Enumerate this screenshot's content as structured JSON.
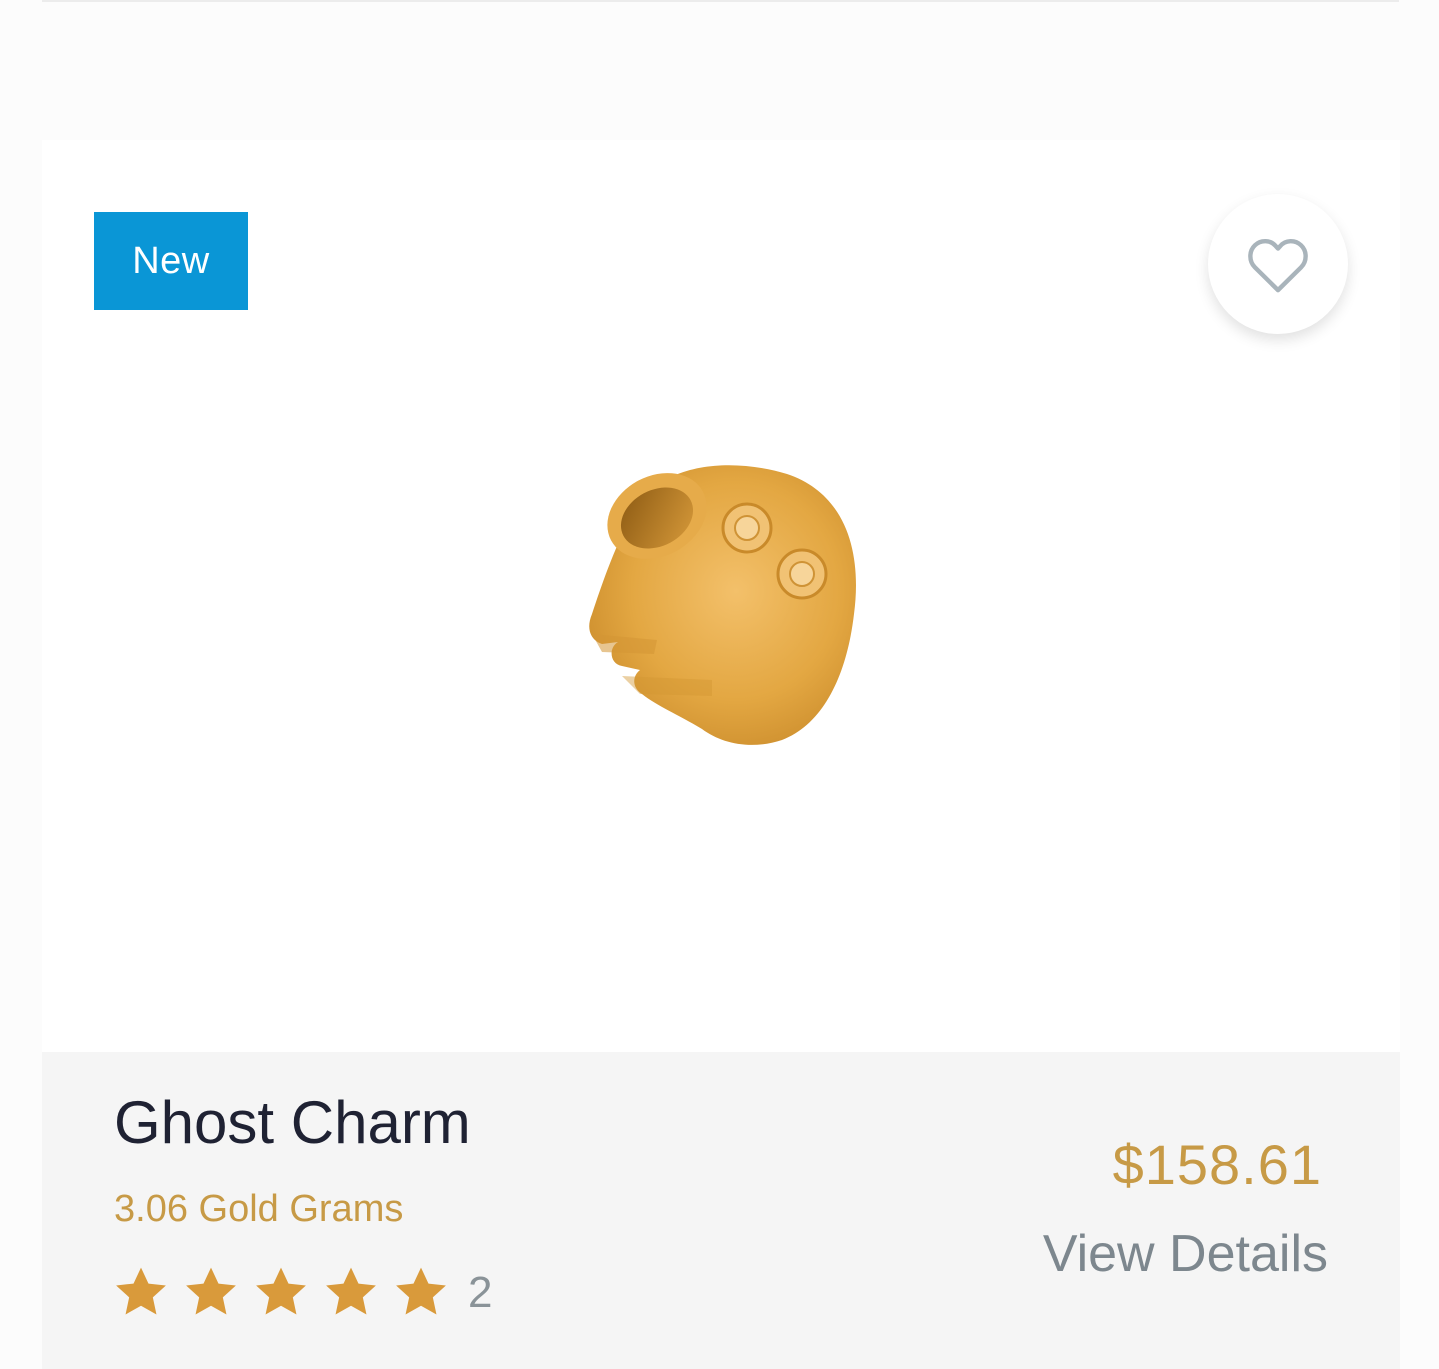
{
  "product": {
    "badge": "New",
    "name": "Ghost Charm",
    "weight": "3.06 Gold Grams",
    "price": "$158.61",
    "view_details": "View Details",
    "rating_value": 5,
    "rating_max": 5,
    "rating_count": "2"
  },
  "colors": {
    "badge": "#0a96d6",
    "gold": "#c79a46",
    "star": "#d99a3b",
    "title": "#1f2233",
    "muted": "#7d878e"
  },
  "icons": {
    "wishlist": "heart-icon",
    "rating": "star-icon"
  }
}
